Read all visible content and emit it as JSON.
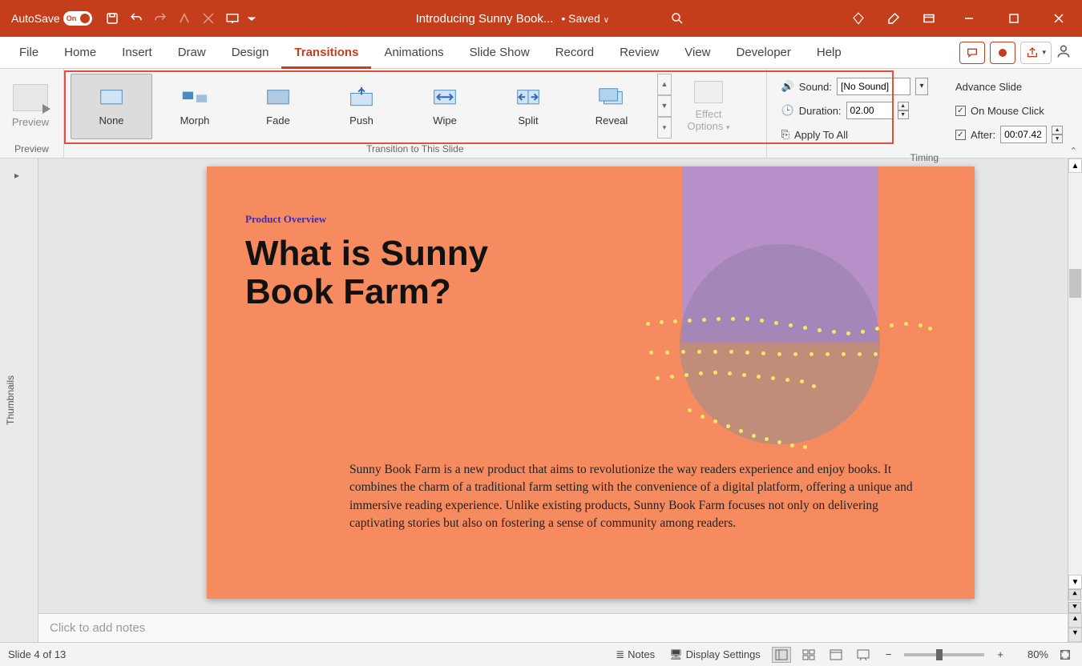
{
  "titlebar": {
    "autosave_label": "AutoSave",
    "autosave_on": "On",
    "doc_title": "Introducing Sunny Book...",
    "saved_status": "• Saved"
  },
  "tabs": {
    "file": "File",
    "home": "Home",
    "insert": "Insert",
    "draw": "Draw",
    "design": "Design",
    "transitions": "Transitions",
    "animations": "Animations",
    "slideshow": "Slide Show",
    "record": "Record",
    "review": "Review",
    "view": "View",
    "developer": "Developer",
    "help": "Help"
  },
  "ribbon": {
    "preview_label": "Preview",
    "preview_group": "Preview",
    "transitions": {
      "none": "None",
      "morph": "Morph",
      "fade": "Fade",
      "push": "Push",
      "wipe": "Wipe",
      "split": "Split",
      "reveal": "Reveal"
    },
    "transition_group": "Transition to This Slide",
    "effect_options": "Effect Options",
    "sound_label": "Sound:",
    "sound_value": "[No Sound]",
    "duration_label": "Duration:",
    "duration_value": "02.00",
    "apply_all": "Apply To All",
    "advance_label": "Advance Slide",
    "mouse_click": "On Mouse Click",
    "after_label": "After:",
    "after_value": "00:07.42",
    "timing_group": "Timing"
  },
  "thumbnails_label": "Thumbnails",
  "slide": {
    "overline": "Product Overview",
    "heading_l1": "What is Sunny",
    "heading_l2": "Book Farm?",
    "body": "Sunny Book Farm is a new product that aims to revolutionize the way readers experience and enjoy books. It combines the charm of a traditional farm setting with the convenience of a digital platform, offering a unique and immersive reading experience. Unlike existing products, Sunny Book Farm focuses not only on delivering captivating stories but also on fostering a sense of community among readers."
  },
  "notes_placeholder": "Click to add notes",
  "statusbar": {
    "slide_info": "Slide 4 of 13",
    "notes": "Notes",
    "display": "Display Settings",
    "zoom": "80%"
  }
}
